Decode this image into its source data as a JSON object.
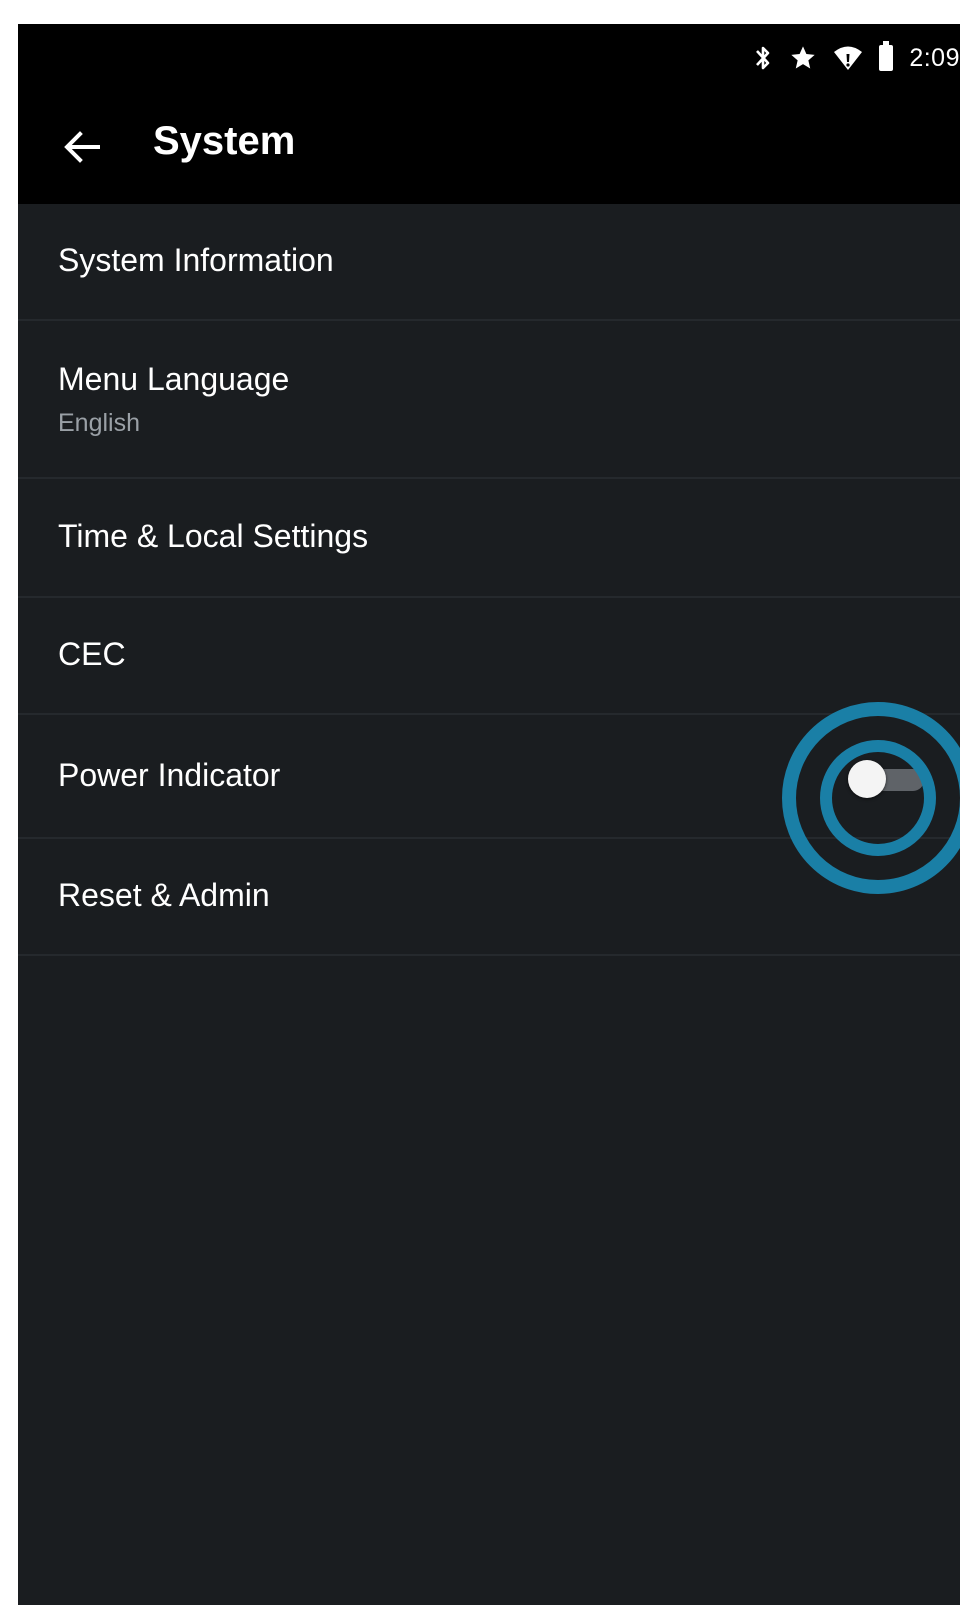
{
  "status_bar": {
    "icons": [
      "bluetooth-icon",
      "star-icon",
      "wifi-icon",
      "battery-icon"
    ],
    "time": "2:09"
  },
  "app_bar": {
    "back_icon": "arrow-left-icon",
    "title": "System"
  },
  "settings": {
    "items": [
      {
        "label": "System Information"
      },
      {
        "label": "Menu Language",
        "value": "English"
      },
      {
        "label": "Time & Local Settings"
      },
      {
        "label": "CEC"
      },
      {
        "label": "Power Indicator",
        "toggle_state": "off"
      },
      {
        "label": "Reset & Admin"
      }
    ]
  },
  "colors": {
    "background": "#1a1d20",
    "bars": "#000000",
    "highlight": "#1a7fa6",
    "toggle_track": "#5f6368",
    "toggle_thumb": "#f4f4f4"
  }
}
